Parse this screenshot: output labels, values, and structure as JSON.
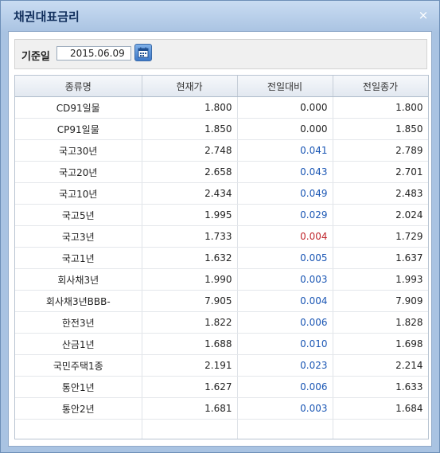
{
  "window": {
    "title": "채권대표금리",
    "close_symbol": "×"
  },
  "filter": {
    "label": "기준일",
    "date_value": "2015.06.09"
  },
  "icons": {
    "calendar": "calendar-icon",
    "close": "close-icon"
  },
  "colors": {
    "up": "#1a56b4",
    "down": "#c0282e",
    "title": "#13315e"
  },
  "table": {
    "columns": [
      "종류명",
      "현재가",
      "전일대비",
      "전일종가"
    ],
    "rows": [
      {
        "name": "CD91일물",
        "current": "1.800",
        "change": "0.000",
        "prev": "1.800",
        "dir": "neutral"
      },
      {
        "name": "CP91일물",
        "current": "1.850",
        "change": "0.000",
        "prev": "1.850",
        "dir": "neutral"
      },
      {
        "name": "국고30년",
        "current": "2.748",
        "change": "0.041",
        "prev": "2.789",
        "dir": "pos"
      },
      {
        "name": "국고20년",
        "current": "2.658",
        "change": "0.043",
        "prev": "2.701",
        "dir": "pos"
      },
      {
        "name": "국고10년",
        "current": "2.434",
        "change": "0.049",
        "prev": "2.483",
        "dir": "pos"
      },
      {
        "name": "국고5년",
        "current": "1.995",
        "change": "0.029",
        "prev": "2.024",
        "dir": "pos"
      },
      {
        "name": "국고3년",
        "current": "1.733",
        "change": "0.004",
        "prev": "1.729",
        "dir": "neg"
      },
      {
        "name": "국고1년",
        "current": "1.632",
        "change": "0.005",
        "prev": "1.637",
        "dir": "pos"
      },
      {
        "name": "회사채3년",
        "current": "1.990",
        "change": "0.003",
        "prev": "1.993",
        "dir": "pos"
      },
      {
        "name": "회사채3년BBB-",
        "current": "7.905",
        "change": "0.004",
        "prev": "7.909",
        "dir": "pos"
      },
      {
        "name": "한전3년",
        "current": "1.822",
        "change": "0.006",
        "prev": "1.828",
        "dir": "pos"
      },
      {
        "name": "산금1년",
        "current": "1.688",
        "change": "0.010",
        "prev": "1.698",
        "dir": "pos"
      },
      {
        "name": "국민주택1종",
        "current": "2.191",
        "change": "0.023",
        "prev": "2.214",
        "dir": "pos"
      },
      {
        "name": "통안1년",
        "current": "1.627",
        "change": "0.006",
        "prev": "1.633",
        "dir": "pos"
      },
      {
        "name": "통안2년",
        "current": "1.681",
        "change": "0.003",
        "prev": "1.684",
        "dir": "pos"
      }
    ]
  }
}
